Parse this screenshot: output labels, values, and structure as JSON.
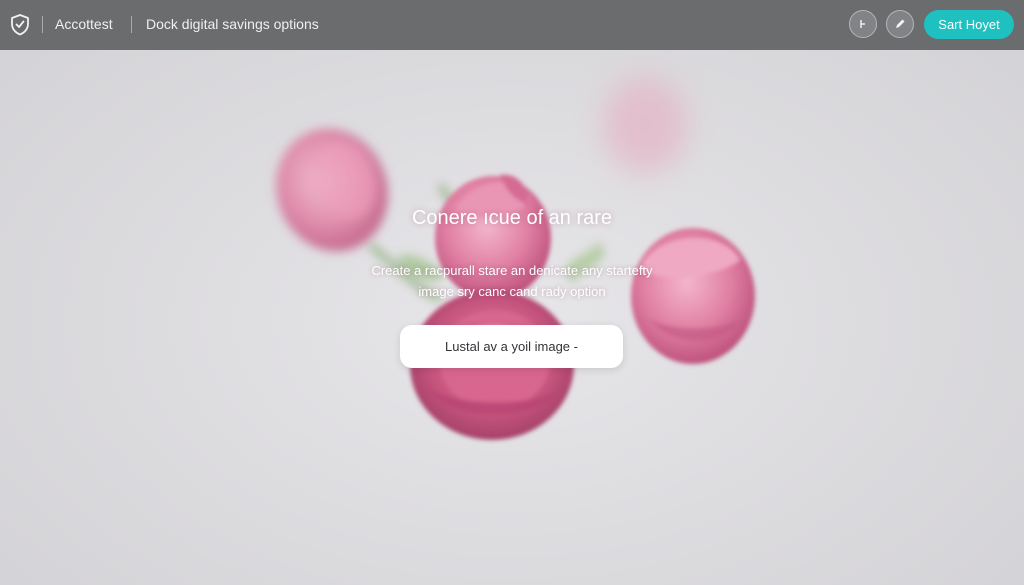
{
  "topbar": {
    "logo_icon": "shield-check-icon",
    "brand": "Accottest",
    "section_title": "Dock digital savings options",
    "icon_buttons": [
      {
        "icon": "cursor-icon"
      },
      {
        "icon": "pencil-icon"
      }
    ],
    "cta_label": "Sart Hoyet"
  },
  "hero": {
    "title": "Conere ıcue of an rare",
    "subtitle_lines": [
      "Create a racpurall stare an denicate any startefty",
      "image sry canc cand rady option"
    ],
    "upload_label": "Lustal av a yoil image -"
  },
  "colors": {
    "topbar": "#6b6c6e",
    "accent": "#1ec1c0",
    "background": "#dddcdf",
    "flower_pink": "#d4688f"
  }
}
